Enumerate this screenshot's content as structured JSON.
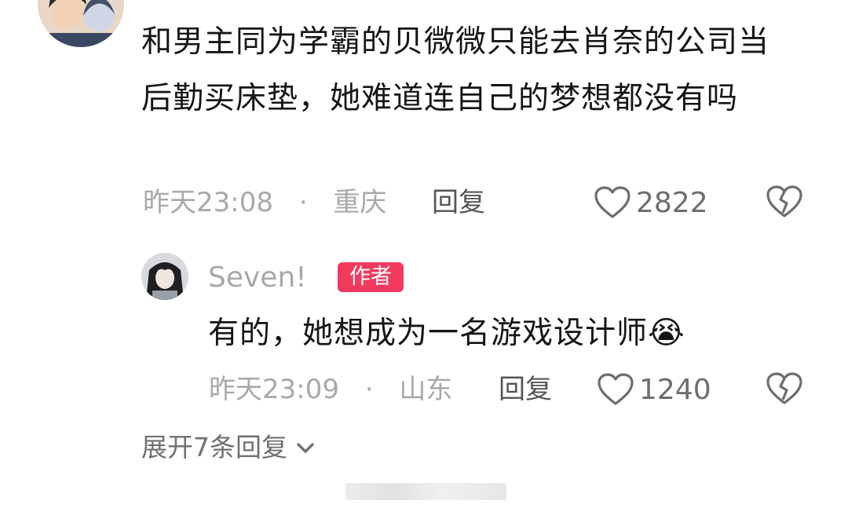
{
  "comment": {
    "text": "和男主同为学霸的贝微微只能去肖奈的公司当后勤买床垫，她难道连自己的梦想都没有吗",
    "time": "昨天23:08",
    "separator": "·",
    "location": "重庆",
    "reply_label": "回复",
    "likes": "2822"
  },
  "reply": {
    "username": "Seven!",
    "badge": "作者",
    "text": "有的，她想成为一名游戏设计师",
    "emoji": "😭",
    "time": "昨天23:09",
    "separator": "·",
    "location": "山东",
    "reply_label": "回复",
    "likes": "1240"
  },
  "expand": {
    "label": "展开7条回复"
  },
  "icons": {
    "like": "heart-outline-icon",
    "dislike": "broken-heart-icon",
    "expand": "chevron-down-icon"
  },
  "colors": {
    "badge": "#f23a5f",
    "text": "#161616",
    "meta": "#a9a9a9"
  }
}
